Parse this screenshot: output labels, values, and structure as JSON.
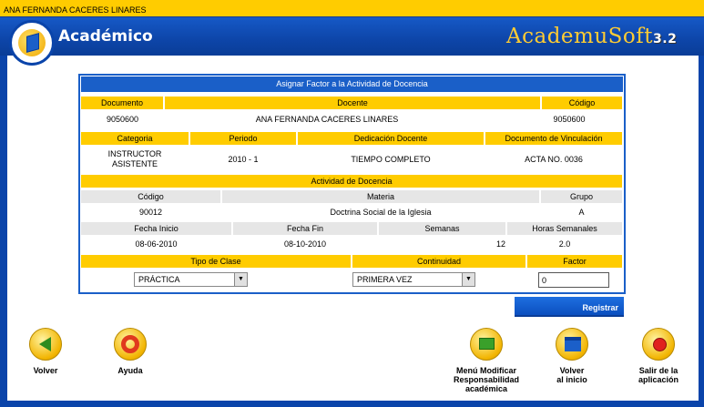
{
  "user_bar": {
    "name": "ANA FERNANDA CACERES LINARES"
  },
  "header": {
    "title": "Académico",
    "brand": "AcademuSoft",
    "version": "3.2"
  },
  "panel": {
    "title": "Asignar Factor a la Actividad de Docencia",
    "docente_headers": {
      "documento": "Documento",
      "docente": "Docente",
      "codigo": "Código"
    },
    "docente_values": {
      "documento": "9050600",
      "docente": "ANA FERNANDA CACERES LINARES",
      "codigo": "9050600"
    },
    "vinculo_headers": {
      "categoria": "Categoria",
      "periodo": "Periodo",
      "dedicacion": "Dedicación Docente",
      "documento_vinculacion": "Documento de Vinculación"
    },
    "vinculo_values": {
      "categoria_1": "INSTRUCTOR",
      "categoria_2": "ASISTENTE",
      "periodo": "2010 - 1",
      "dedicacion": "TIEMPO COMPLETO",
      "documento_vinculacion": "ACTA NO. 0036"
    },
    "actividad_title": "Actividad de Docencia",
    "materia_headers": {
      "codigo": "Código",
      "materia": "Materia",
      "grupo": "Grupo"
    },
    "materia_values": {
      "codigo": "90012",
      "materia": "Doctrina Social de la Iglesia",
      "grupo": "A"
    },
    "fechas_headers": {
      "fecha_inicio": "Fecha Inicio",
      "fecha_fin": "Fecha Fin",
      "semanas": "Semanas",
      "horas": "Horas Semanales"
    },
    "fechas_values": {
      "fecha_inicio": "08-06-2010",
      "fecha_fin": "08-10-2010",
      "semanas": "12",
      "horas": "2.0"
    },
    "clase_headers": {
      "tipo": "Tipo de Clase",
      "continuidad": "Continuidad",
      "factor": "Factor"
    },
    "clase_values": {
      "tipo": "PRÁCTICA",
      "continuidad": "PRIMERA VEZ",
      "factor": "0"
    }
  },
  "register_button": "Registrar",
  "nav": {
    "volver": "Volver",
    "ayuda": "Ayuda",
    "menu_line1": "Menú Modificar",
    "menu_line2": "Responsabilidad",
    "menu_line3": "académica",
    "inicio_line1": "Volver",
    "inicio_line2": "al inicio",
    "salir_line1": "Salir de la",
    "salir_line2": "aplicación"
  },
  "colors": {
    "blue": "#1a5fc8",
    "yellow": "#ffcc00",
    "gray": "#e6e6e6"
  }
}
